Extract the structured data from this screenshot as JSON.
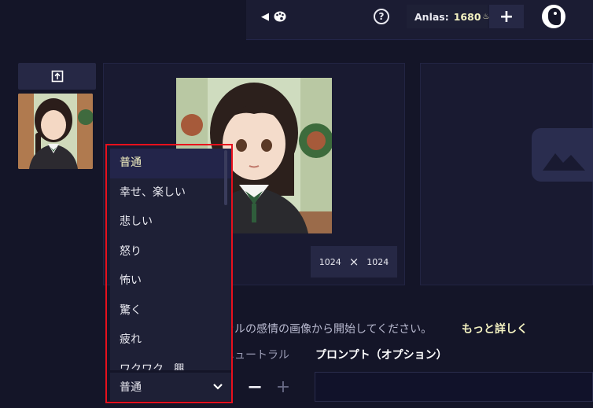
{
  "topbar": {
    "back_icon": "chevron-left-icon",
    "palette_icon": "palette-icon",
    "help_icon": "question-circle-icon",
    "help_glyph": "?",
    "anlas_label": "Anlas:",
    "anlas_value": "1680",
    "anlas_icon": "anlas-icon",
    "add_glyph": "+",
    "avatar_icon": "user-avatar-icon"
  },
  "sidebar": {
    "upload_icon": "upload-icon"
  },
  "canvas": {
    "width": "1024",
    "height": "1024",
    "times_glyph": "×"
  },
  "emotion": {
    "info_text": "ラルの感情の画像から開始してください。",
    "more_link": "もっと詳しく",
    "neutral_label": "ニュートラル",
    "prompt_label": "プロンプト（オプション）",
    "selected": "普通",
    "options": [
      "普通",
      "幸せ、楽しい",
      "悲しい",
      "怒り",
      "怖い",
      "驚く",
      "疲れ",
      "ワクワク、興"
    ],
    "minus_glyph": "−",
    "plus_glyph": "+"
  },
  "colors": {
    "background": "#141528",
    "panel": "#191a31",
    "accent": "#f5f3c2",
    "highlight": "#e8101c"
  }
}
